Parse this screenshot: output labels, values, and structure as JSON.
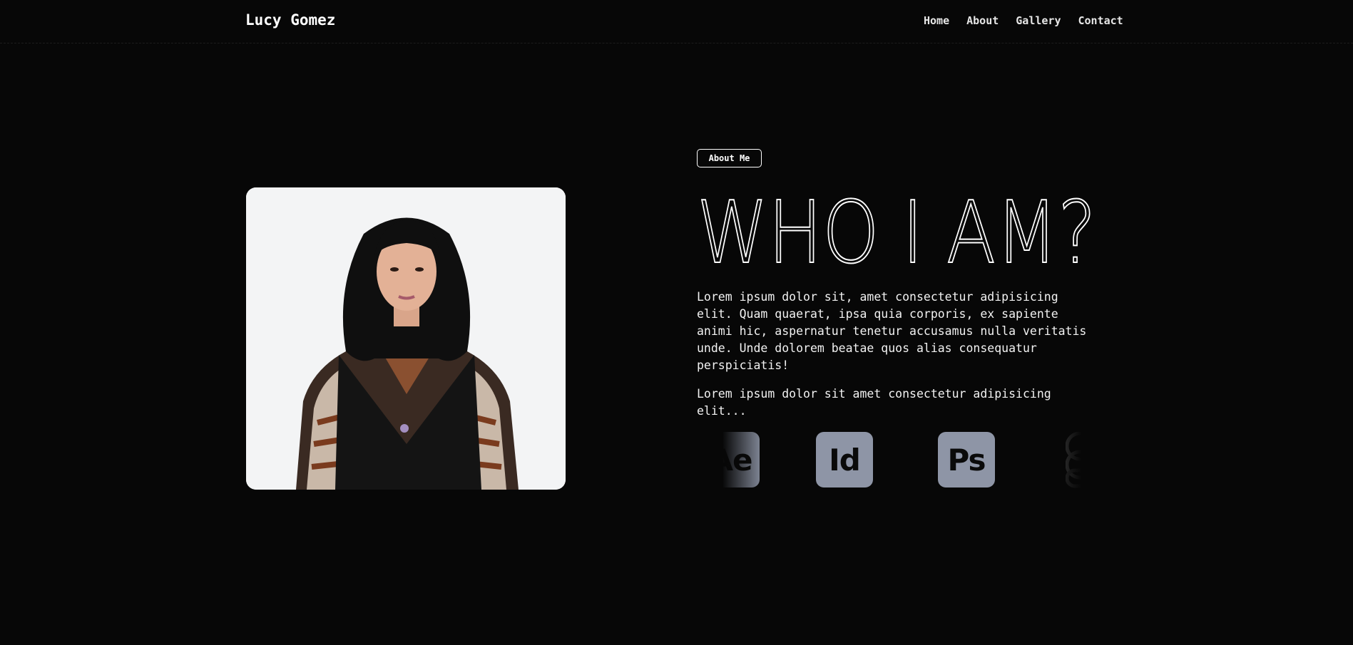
{
  "header": {
    "brand": "Lucy Gomez",
    "nav": [
      "Home",
      "About",
      "Gallery",
      "Contact"
    ]
  },
  "about": {
    "badge": "About Me",
    "headline": "WHO I AM?",
    "paragraph_1": "Lorem ipsum dolor sit, amet consectetur adipisicing elit. Quam quaerat, ipsa quia corporis, ex sapiente animi hic, aspernatur tenetur accusamus nulla veritatis unde. Unde dolorem beatae quos alias consequatur perspiciatis!",
    "paragraph_2": "Lorem ipsum dolor sit amet consectetur adipisicing elit..."
  },
  "skills": [
    {
      "label": "Ae",
      "icon": "after-effects-icon"
    },
    {
      "label": "Id",
      "icon": "indesign-icon"
    },
    {
      "label": "Ps",
      "icon": "photoshop-icon"
    },
    {
      "label": "",
      "icon": "chain-link-icon"
    }
  ],
  "colors": {
    "background": "#070707",
    "text": "#ffffff",
    "skill_tile": "#8e95a6"
  }
}
